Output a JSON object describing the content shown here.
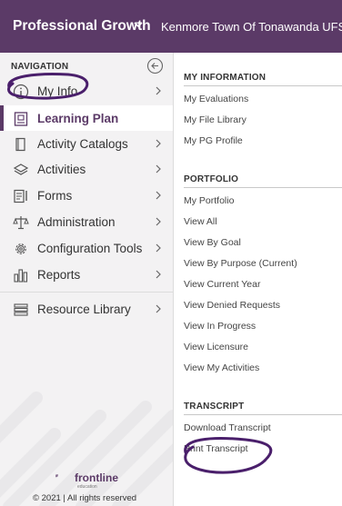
{
  "header": {
    "app_title": "Professional Growth",
    "org_name": "Kenmore Town Of Tonawanda UFSD"
  },
  "colors": {
    "brand": "#5b3a67",
    "sidebar_bg": "#f3f2f3",
    "annotation": "#4a1f6b"
  },
  "sidebar": {
    "heading": "NAVIGATION",
    "items": [
      {
        "label": "My Info",
        "icon": "info-circle-icon",
        "chevron": true
      },
      {
        "label": "Learning Plan",
        "icon": "learning-plan-icon",
        "chevron": false,
        "active": true
      },
      {
        "label": "Activity Catalogs",
        "icon": "book-icon",
        "chevron": true
      },
      {
        "label": "Activities",
        "icon": "layers-icon",
        "chevron": true
      },
      {
        "label": "Forms",
        "icon": "form-icon",
        "chevron": true
      },
      {
        "label": "Administration",
        "icon": "scales-icon",
        "chevron": true
      },
      {
        "label": "Configuration Tools",
        "icon": "gear-icon",
        "chevron": true
      },
      {
        "label": "Reports",
        "icon": "bar-chart-icon",
        "chevron": true
      },
      {
        "label": "Resource Library",
        "icon": "library-icon",
        "chevron": true
      }
    ]
  },
  "footer": {
    "logo_text": "frontline",
    "logo_sub": "education",
    "copyright": "© 2021 | All rights reserved"
  },
  "menu": {
    "sections": [
      {
        "title": "MY INFORMATION",
        "links": [
          "My Evaluations",
          "My File Library",
          "My PG Profile"
        ]
      },
      {
        "title": "PORTFOLIO",
        "links": [
          "My Portfolio",
          "View All",
          "View By Goal",
          "View By Purpose (Current)",
          "View Current Year",
          "View Denied Requests",
          "View In Progress",
          "View Licensure",
          "View My Activities"
        ]
      },
      {
        "title": "TRANSCRIPT",
        "links": [
          "Download Transcript",
          "Print Transcript"
        ]
      }
    ]
  }
}
